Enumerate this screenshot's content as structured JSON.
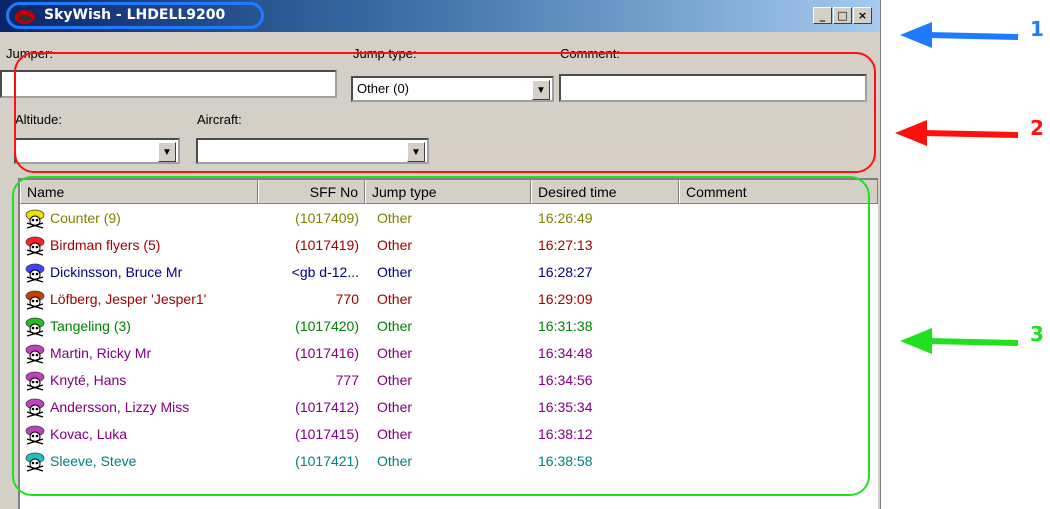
{
  "window": {
    "title": "SkyWish - LHDELL9200",
    "controls": {
      "minimize": "_",
      "maximize": "□",
      "close": "×"
    }
  },
  "form": {
    "jumper_label": "Jumper:",
    "jumper_value": "",
    "jump_type_label": "Jump type:",
    "jump_type_value": "Other (0)",
    "comment_label": "Comment:",
    "comment_value": "",
    "altitude_label": "Altitude:",
    "altitude_value": "",
    "aircraft_label": "Aircraft:",
    "aircraft_value": ""
  },
  "list": {
    "columns": [
      "Name",
      "SFF No",
      "Jump type",
      "Desired time",
      "Comment"
    ],
    "rows": [
      {
        "name": "Counter (9)",
        "sff": "(1017409)",
        "type": "Other",
        "time": "16:26:49",
        "comment": "",
        "color": "#808000",
        "helmet": "#f0e000"
      },
      {
        "name": "Birdman flyers (5)",
        "sff": "(1017419)",
        "type": "Other",
        "time": "16:27:13",
        "comment": "",
        "color": "#a00000",
        "helmet": "#ff2020"
      },
      {
        "name": "Dickinsson, Bruce Mr",
        "sff": "<gb d-12...",
        "type": "Other",
        "time": "16:28:27",
        "comment": "",
        "color": "#000080",
        "helmet": "#4040ff"
      },
      {
        "name": "Löfberg, Jesper 'Jesper1'",
        "sff": "770",
        "type": "Other",
        "time": "16:29:09",
        "comment": "",
        "color": "#a00000",
        "helmet": "#c04010"
      },
      {
        "name": "Tangeling (3)",
        "sff": "(1017420)",
        "type": "Other",
        "time": "16:31:38",
        "comment": "",
        "color": "#008000",
        "helmet": "#20c020"
      },
      {
        "name": "Martin, Ricky Mr",
        "sff": "(1017416)",
        "type": "Other",
        "time": "16:34:48",
        "comment": "",
        "color": "#800080",
        "helmet": "#c040c0"
      },
      {
        "name": "Knyté, Hans",
        "sff": "777",
        "type": "Other",
        "time": "16:34:56",
        "comment": "",
        "color": "#800080",
        "helmet": "#c040c0"
      },
      {
        "name": "Andersson, Lizzy Miss",
        "sff": "(1017412)",
        "type": "Other",
        "time": "16:35:34",
        "comment": "",
        "color": "#800080",
        "helmet": "#c040c0"
      },
      {
        "name": "Kovac, Luka",
        "sff": "(1017415)",
        "type": "Other",
        "time": "16:38:12",
        "comment": "",
        "color": "#800080",
        "helmet": "#c040c0"
      },
      {
        "name": "Sleeve, Steve",
        "sff": "(1017421)",
        "type": "Other",
        "time": "16:38:58",
        "comment": "",
        "color": "#008080",
        "helmet": "#20c0c0"
      }
    ]
  },
  "annotations": {
    "callout_1": "1",
    "callout_2": "2",
    "callout_3": "3",
    "colors": {
      "blue": "#1e7bff",
      "red": "#ff1010",
      "green": "#20e020"
    }
  }
}
